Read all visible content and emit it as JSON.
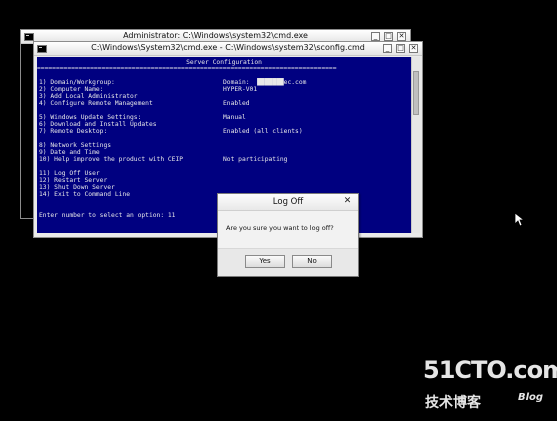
{
  "window_back": {
    "title": "Administrator: C:\\Windows\\system32\\cmd.exe",
    "buttons": [
      "_",
      "□",
      "✕"
    ]
  },
  "window_front": {
    "title": "C:\\Windows\\System32\\cmd.exe - C:\\Windows\\system32\\sconfig.cmd",
    "buttons": [
      "_",
      "□",
      "✕"
    ],
    "console": {
      "header": "Server Configuration",
      "rule": "===============================================================================",
      "menu": [
        {
          "label": "1) Domain/Workgroup:",
          "value": "Domain:  ███████ec.com"
        },
        {
          "label": "2) Computer Name:",
          "value": "HYPER-V01"
        },
        {
          "label": "3) Add Local Administrator",
          "value": ""
        },
        {
          "label": "4) Configure Remote Management",
          "value": "Enabled"
        },
        {
          "label": "5) Windows Update Settings:",
          "value": "Manual"
        },
        {
          "label": "6) Download and Install Updates",
          "value": ""
        },
        {
          "label": "7) Remote Desktop:",
          "value": "Enabled (all clients)"
        },
        {
          "label": "8) Network Settings",
          "value": ""
        },
        {
          "label": "9) Date and Time",
          "value": ""
        },
        {
          "label": "10) Help improve the product with CEIP",
          "value": "Not participating"
        },
        {
          "label": "11) Log Off User",
          "value": ""
        },
        {
          "label": "12) Restart Server",
          "value": ""
        },
        {
          "label": "13) Shut Down Server",
          "value": ""
        },
        {
          "label": "14) Exit to Command Line",
          "value": ""
        }
      ],
      "prompt": "Enter number to select an option: 11"
    }
  },
  "dialog": {
    "title": "Log Off",
    "close": "✕",
    "message": "Are you sure you want to log off?",
    "yes_label": "Yes",
    "no_label": "No"
  },
  "watermark": {
    "main": "51CTO.com",
    "sub": "技术博客",
    "blog": "Blog"
  }
}
